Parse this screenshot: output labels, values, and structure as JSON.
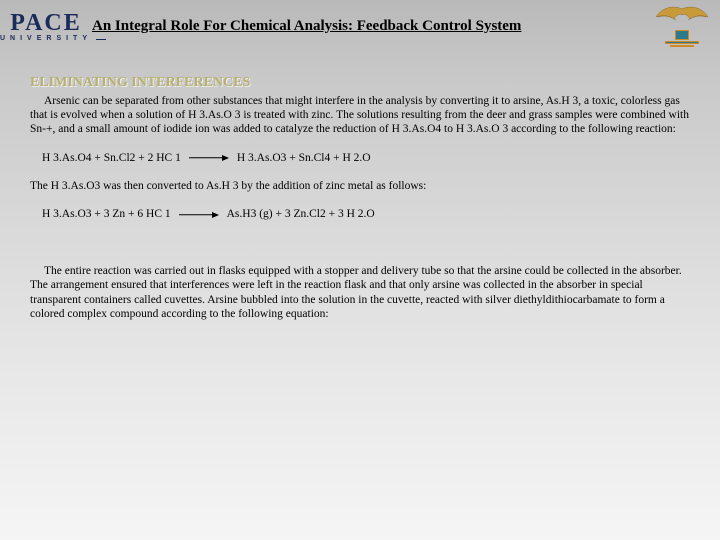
{
  "logo": {
    "name": "PACE",
    "subname": "UNIVERSITY"
  },
  "title": "An Integral Role For Chemical Analysis: Feedback Control System",
  "section": {
    "heading": "ELIMINATING INTERFERENCES",
    "intro": "Arsenic can be separated from other substances that might interfere in the analysis by converting it to arsine, As.H 3, a toxic, colorless gas that is evolved when a solution of H 3.As.O 3 is treated with zinc. The solutions resulting from the deer and grass samples were combined with Sn-+, and a small amount of iodide ion was added to catalyze the reduction of H 3.As.O4 to H 3.As.O 3 according to the following reaction:",
    "eq1_left": "H 3.As.O4 + Sn.Cl2 + 2 HC 1",
    "eq1_right": "H 3.As.O3 + Sn.Cl4 + H 2.O",
    "mid": "The H 3.As.O3 was then converted to As.H 3 by the addition of zinc metal as follows:",
    "eq2_left": "H 3.As.O3 + 3 Zn + 6 HC 1",
    "eq2_right": "As.H3 (g) + 3 Zn.Cl2 + 3 H 2.O",
    "tail": "The entire reaction was carried out in flasks equipped with a stopper and delivery tube so that the arsine could be collected in the absorber. The arrangement ensured that interferences were left in the reaction flask and that only arsine was collected in the absorber in special transparent containers called cuvettes. Arsine bubbled into the solution in the cuvette, reacted with silver diethyldithiocarbamate to form a colored complex compound according to the following equation:"
  }
}
